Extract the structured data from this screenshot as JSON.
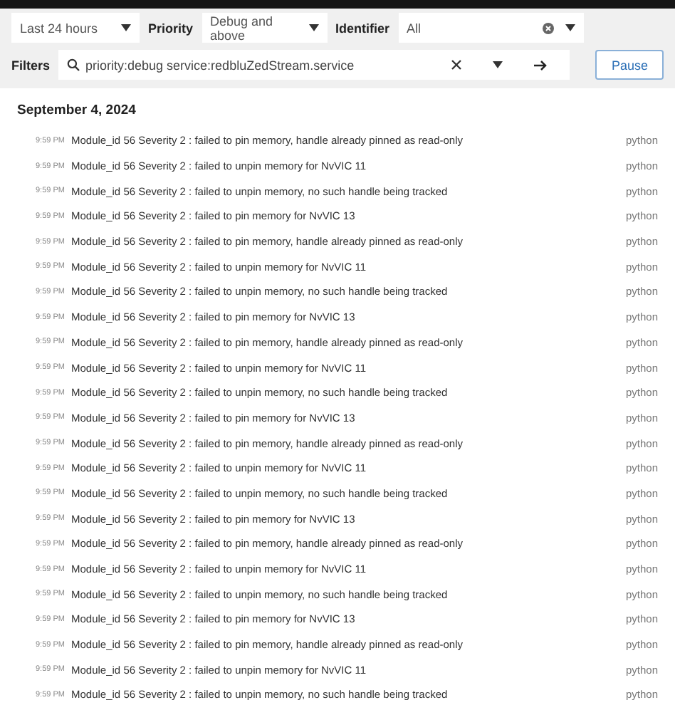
{
  "toolbar": {
    "time_range": {
      "value": "Last 24 hours"
    },
    "priority": {
      "label": "Priority",
      "value": "Debug and above"
    },
    "identifier": {
      "label": "Identifier",
      "value": "All"
    },
    "filters": {
      "label": "Filters",
      "value": "priority:debug service:redbluZedStream.service"
    },
    "pause_button": "Pause"
  },
  "log": {
    "date": "September 4, 2024",
    "entries": [
      {
        "time": "9:59 PM",
        "message": "Module_id 56 Severity 2 : failed to pin memory, handle already pinned as read-only",
        "identifier": "python"
      },
      {
        "time": "9:59 PM",
        "message": "Module_id 56 Severity 2 : failed to unpin memory for NvVIC 11",
        "identifier": "python"
      },
      {
        "time": "9:59 PM",
        "message": "Module_id 56 Severity 2 : failed to unpin memory, no such handle being tracked",
        "identifier": "python"
      },
      {
        "time": "9:59 PM",
        "message": "Module_id 56 Severity 2 : failed to pin memory for NvVIC 13",
        "identifier": "python"
      },
      {
        "time": "9:59 PM",
        "message": "Module_id 56 Severity 2 : failed to pin memory, handle already pinned as read-only",
        "identifier": "python"
      },
      {
        "time": "9:59 PM",
        "message": "Module_id 56 Severity 2 : failed to unpin memory for NvVIC 11",
        "identifier": "python"
      },
      {
        "time": "9:59 PM",
        "message": "Module_id 56 Severity 2 : failed to unpin memory, no such handle being tracked",
        "identifier": "python"
      },
      {
        "time": "9:59 PM",
        "message": "Module_id 56 Severity 2 : failed to pin memory for NvVIC 13",
        "identifier": "python"
      },
      {
        "time": "9:59 PM",
        "message": "Module_id 56 Severity 2 : failed to pin memory, handle already pinned as read-only",
        "identifier": "python"
      },
      {
        "time": "9:59 PM",
        "message": "Module_id 56 Severity 2 : failed to unpin memory for NvVIC 11",
        "identifier": "python"
      },
      {
        "time": "9:59 PM",
        "message": "Module_id 56 Severity 2 : failed to unpin memory, no such handle being tracked",
        "identifier": "python"
      },
      {
        "time": "9:59 PM",
        "message": "Module_id 56 Severity 2 : failed to pin memory for NvVIC 13",
        "identifier": "python"
      },
      {
        "time": "9:59 PM",
        "message": "Module_id 56 Severity 2 : failed to pin memory, handle already pinned as read-only",
        "identifier": "python"
      },
      {
        "time": "9:59 PM",
        "message": "Module_id 56 Severity 2 : failed to unpin memory for NvVIC 11",
        "identifier": "python"
      },
      {
        "time": "9:59 PM",
        "message": "Module_id 56 Severity 2 : failed to unpin memory, no such handle being tracked",
        "identifier": "python"
      },
      {
        "time": "9:59 PM",
        "message": "Module_id 56 Severity 2 : failed to pin memory for NvVIC 13",
        "identifier": "python"
      },
      {
        "time": "9:59 PM",
        "message": "Module_id 56 Severity 2 : failed to pin memory, handle already pinned as read-only",
        "identifier": "python"
      },
      {
        "time": "9:59 PM",
        "message": "Module_id 56 Severity 2 : failed to unpin memory for NvVIC 11",
        "identifier": "python"
      },
      {
        "time": "9:59 PM",
        "message": "Module_id 56 Severity 2 : failed to unpin memory, no such handle being tracked",
        "identifier": "python"
      },
      {
        "time": "9:59 PM",
        "message": "Module_id 56 Severity 2 : failed to pin memory for NvVIC 13",
        "identifier": "python"
      },
      {
        "time": "9:59 PM",
        "message": "Module_id 56 Severity 2 : failed to pin memory, handle already pinned as read-only",
        "identifier": "python"
      },
      {
        "time": "9:59 PM",
        "message": "Module_id 56 Severity 2 : failed to unpin memory for NvVIC 11",
        "identifier": "python"
      },
      {
        "time": "9:59 PM",
        "message": "Module_id 56 Severity 2 : failed to unpin memory, no such handle being tracked",
        "identifier": "python"
      }
    ]
  }
}
